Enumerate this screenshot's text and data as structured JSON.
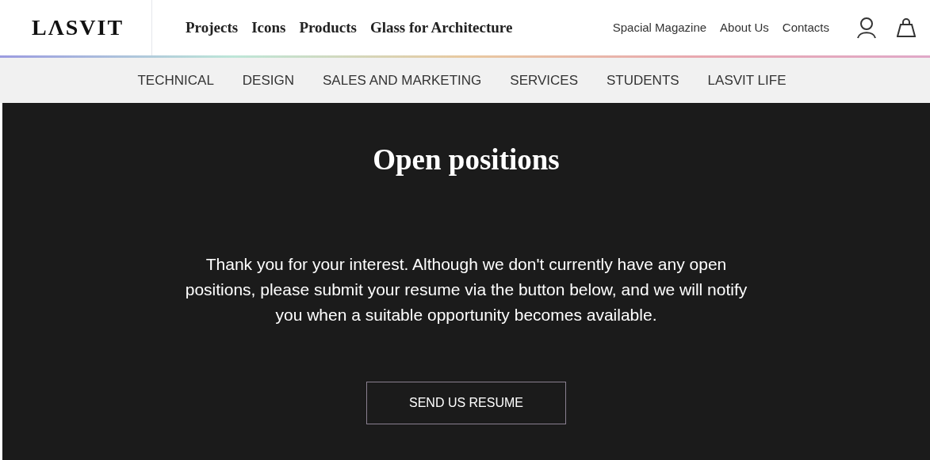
{
  "header": {
    "logo": "LΛSVIT",
    "main_nav": [
      {
        "label": "Projects"
      },
      {
        "label": "Icons"
      },
      {
        "label": "Products"
      },
      {
        "label": "Glass for Architecture"
      }
    ],
    "secondary_nav": [
      {
        "label": "Spacial Magazine"
      },
      {
        "label": "About Us"
      },
      {
        "label": "Contacts"
      }
    ]
  },
  "sub_nav": [
    {
      "label": "TECHNICAL"
    },
    {
      "label": "DESIGN"
    },
    {
      "label": "SALES AND MARKETING"
    },
    {
      "label": "SERVICES"
    },
    {
      "label": "STUDENTS"
    },
    {
      "label": "LASVIT LIFE"
    }
  ],
  "content": {
    "title": "Open positions",
    "message": "Thank you for your interest. Although we don't currently have any open positions, please submit your resume via the button below, and we will notify you when a suitable opportunity becomes available.",
    "button": "SEND US RESUME"
  }
}
